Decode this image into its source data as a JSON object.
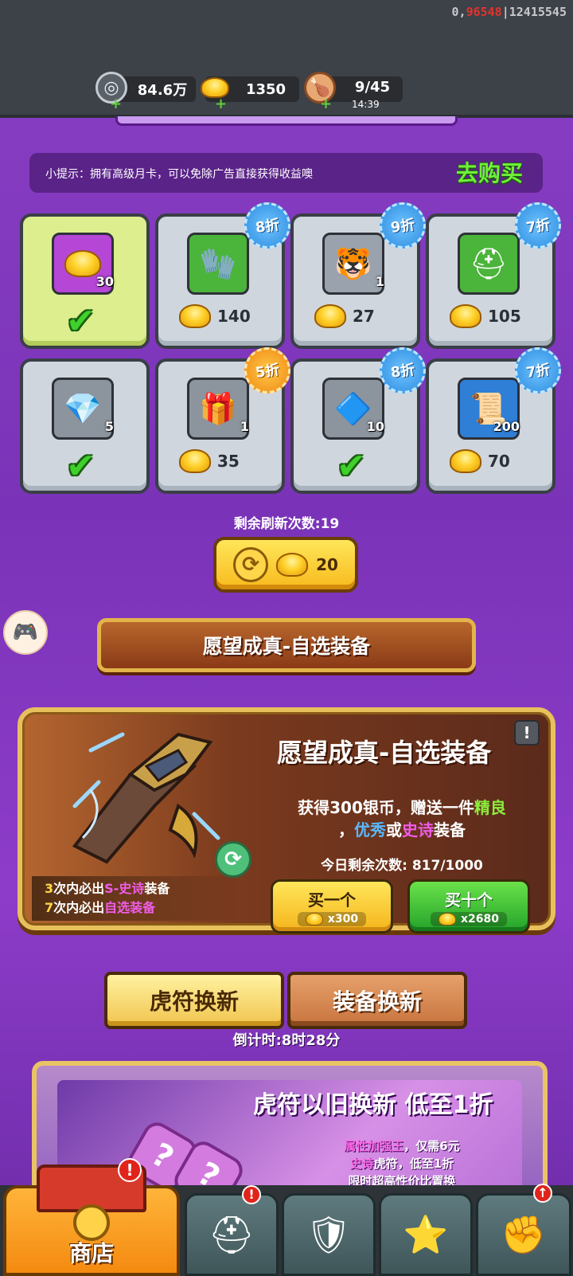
{
  "status": {
    "server_id_prefix": "0,",
    "server_id_red": "96548",
    "server_id_suffix": "|12415545"
  },
  "resources": {
    "silver": {
      "value": "84.6万",
      "icon": "silver-coin-icon"
    },
    "gold": {
      "value": "1350",
      "icon": "gold-ingot-icon"
    },
    "stamina": {
      "value": "9/45",
      "timer": "14:39",
      "icon": "meat-drumstick-icon"
    }
  },
  "tip": {
    "text": "小提示：拥有高级月卡，可以免除广告直接获得收益噢",
    "buy_label": "去购买"
  },
  "shop_items": [
    {
      "count": "30",
      "price": "",
      "discount": "",
      "purchased": true,
      "selected": true,
      "icon": "gold-ingot-icon",
      "box_color": "#b646d6",
      "glyph": "💰"
    },
    {
      "count": "",
      "price": "140",
      "discount": "8折",
      "purchased": false,
      "icon": "gauntlet-icon",
      "box_color": "#4bb43a",
      "glyph": "🧤"
    },
    {
      "count": "1",
      "price": "27",
      "discount": "9折",
      "purchased": false,
      "icon": "tiger-token-icon",
      "box_color": "#9aa3ad",
      "glyph": "🐯"
    },
    {
      "count": "",
      "price": "105",
      "discount": "7折",
      "purchased": false,
      "icon": "helmet-icon",
      "box_color": "#4bb43a",
      "glyph": "⛑"
    },
    {
      "count": "5",
      "price": "",
      "discount": "",
      "purchased": true,
      "icon": "blue-gem-icon",
      "box_color": "#8c949e",
      "glyph": "💎"
    },
    {
      "count": "1",
      "price": "35",
      "discount": "5折",
      "purchased": false,
      "icon": "gift-pouch-icon",
      "box_color": "#8c949e",
      "glyph": "🎁"
    },
    {
      "count": "10",
      "price": "",
      "discount": "8折",
      "purchased": true,
      "icon": "crystal-icon",
      "box_color": "#8c949e",
      "glyph": "🔷"
    },
    {
      "count": "200",
      "price": "70",
      "discount": "7折",
      "purchased": false,
      "icon": "scroll-icon",
      "box_color": "#2f7fd6",
      "glyph": "📜"
    }
  ],
  "refresh": {
    "remaining_label": "剩余刷新次数:19",
    "cost": "20"
  },
  "wish_section": {
    "banner_title": "愿望成真-自选装备",
    "panel_title": "愿望成真-自选装备",
    "desc_part1": "获得300银币，赠送一件",
    "desc_good": "精良",
    "desc_sep": "，",
    "desc_excellent": "优秀",
    "desc_or": "或",
    "desc_epic": "史诗",
    "desc_end": "装备",
    "remaining": "今日剩余次数: 817/1000",
    "guarantee1_num": "3",
    "guarantee1_pre": "次内必出",
    "guarantee1_hl": "S-史诗",
    "guarantee1_post": "装备",
    "guarantee2_num": "7",
    "guarantee2_pre": "次内必出",
    "guarantee2_hl": "自选装备",
    "buy_one_label": "买一个",
    "buy_one_cost": "x300",
    "buy_ten_label": "买十个",
    "buy_ten_cost": "x2680"
  },
  "exchange": {
    "tab_tiger": "虎符换新",
    "tab_equip": "装备换新",
    "countdown": "倒计时:8时28分"
  },
  "promo": {
    "title": "虎符以旧换新 低至1折",
    "line1_hl": "属性加强王",
    "line1_rest": "，仅需6元",
    "line2_hl": "史诗",
    "line2_rest": "虎符，低至1折",
    "line3": "限时超高性价比置换"
  },
  "nav": {
    "shop_label": "商店"
  },
  "colors": {
    "accent_green": "#6ff039",
    "purple_bg": "#8a3fc4",
    "gold": "#ffd028"
  }
}
